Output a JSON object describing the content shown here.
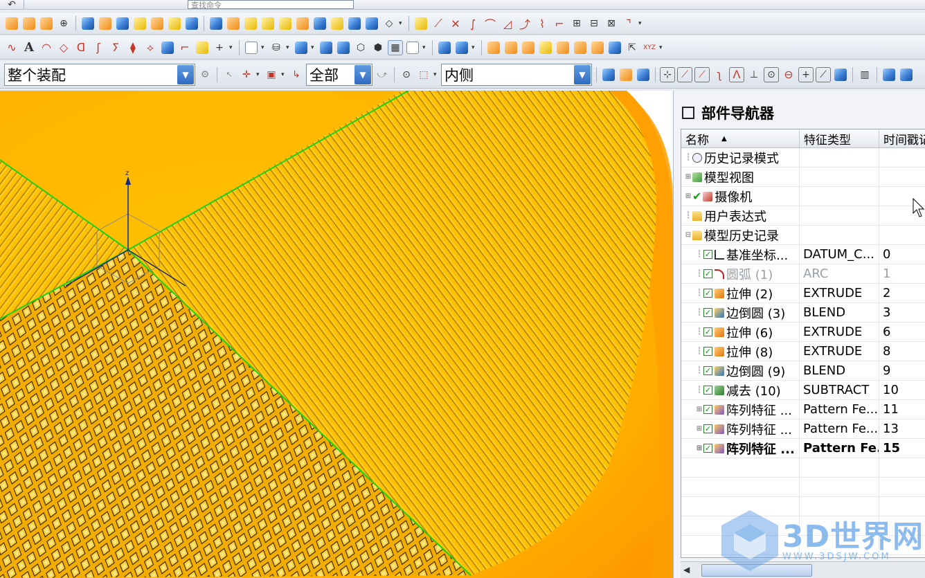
{
  "toolbar": {
    "command_search_placeholder": "查找命令",
    "selection_filter": "整个装配",
    "scope_filter": "全部",
    "inside_filter": "内侧"
  },
  "navigator": {
    "title": "部件导航器",
    "columns": [
      "名称",
      "特征类型",
      "时间戳记"
    ],
    "rows": [
      {
        "tree": "",
        "icon": "clock-icon",
        "name": "历史记录模式",
        "type": "",
        "time": "",
        "style": ""
      },
      {
        "tree": "+",
        "icon": "model-view-icon",
        "name": "模型视图",
        "type": "",
        "time": "",
        "style": ""
      },
      {
        "tree": "+",
        "icon": "camera-icon",
        "name": "摄像机",
        "type": "",
        "time": "",
        "style": "",
        "check": "✔"
      },
      {
        "tree": "",
        "icon": "folder-icon",
        "name": "用户表达式",
        "type": "",
        "time": "",
        "style": ""
      },
      {
        "tree": "−",
        "icon": "folder-icon",
        "name": "模型历史记录",
        "type": "",
        "time": "",
        "style": ""
      },
      {
        "tree": "",
        "icon": "datum-csys-icon",
        "name": "基准坐标...",
        "type": "DATUM_C...",
        "time": "0",
        "style": ""
      },
      {
        "tree": "",
        "icon": "arc-icon",
        "name": "圆弧 (1)",
        "type": "ARC",
        "time": "1",
        "style": "disabled"
      },
      {
        "tree": "",
        "icon": "extrude-icon",
        "name": "拉伸 (2)",
        "type": "EXTRUDE",
        "time": "2",
        "style": ""
      },
      {
        "tree": "",
        "icon": "edge-blend-icon",
        "name": "边倒圆 (3)",
        "type": "BLEND",
        "time": "3",
        "style": ""
      },
      {
        "tree": "",
        "icon": "extrude-icon",
        "name": "拉伸 (6)",
        "type": "EXTRUDE",
        "time": "6",
        "style": ""
      },
      {
        "tree": "",
        "icon": "extrude-icon",
        "name": "拉伸 (8)",
        "type": "EXTRUDE",
        "time": "8",
        "style": ""
      },
      {
        "tree": "",
        "icon": "edge-blend-icon",
        "name": "边倒圆 (9)",
        "type": "BLEND",
        "time": "9",
        "style": ""
      },
      {
        "tree": "",
        "icon": "subtract-icon",
        "name": "减去 (10)",
        "type": "SUBTRACT",
        "time": "10",
        "style": ""
      },
      {
        "tree": "+",
        "icon": "pattern-feature-icon",
        "name": "阵列特征 ...",
        "type": "Pattern Fe...",
        "time": "11",
        "style": ""
      },
      {
        "tree": "+",
        "icon": "pattern-feature-icon",
        "name": "阵列特征 ...",
        "type": "Pattern Fe...",
        "time": "13",
        "style": ""
      },
      {
        "tree": "+",
        "icon": "pattern-feature-icon",
        "name": "阵列特征 ...",
        "type": "Pattern Fe...",
        "time": "15",
        "style": "bold"
      }
    ]
  },
  "viewport": {
    "axis_label": "z"
  },
  "watermark": {
    "brand": "3D世界网",
    "url": "WWW.3DSJW.COM"
  },
  "colors": {
    "model_yellow": "#ffc400",
    "model_orange": "#ff9d00",
    "edge_green": "#19d219",
    "accent_blue": "#2f6cc0"
  }
}
